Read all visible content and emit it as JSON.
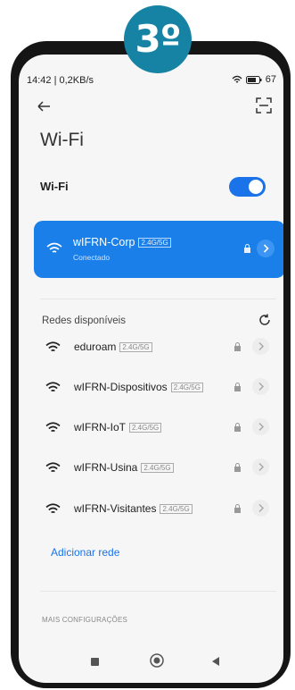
{
  "badge": "3º",
  "status": {
    "time_info": "14:42 | 0,2KB/s",
    "battery": "67"
  },
  "title": "Wi-Fi",
  "wifi_label": "Wi-Fi",
  "connected": {
    "name": "wIFRN-Corp",
    "band": "2.4G/5G",
    "status": "Conectado"
  },
  "available_title": "Redes disponíveis",
  "networks": [
    {
      "name": "eduroam",
      "band": "2.4G/5G"
    },
    {
      "name": "wIFRN-Dispositivos",
      "band": "2.4G/5G"
    },
    {
      "name": "wIFRN-IoT",
      "band": "2.4G/5G"
    },
    {
      "name": "wIFRN-Usina",
      "band": "2.4G/5G"
    },
    {
      "name": "wIFRN-Visitantes",
      "band": "2.4G/5G"
    }
  ],
  "add_network": "Adicionar rede",
  "more_settings": "MAIS CONFIGURAÇÕES",
  "colors": {
    "accent": "#1a7fe8",
    "badge": "#1683a4"
  }
}
